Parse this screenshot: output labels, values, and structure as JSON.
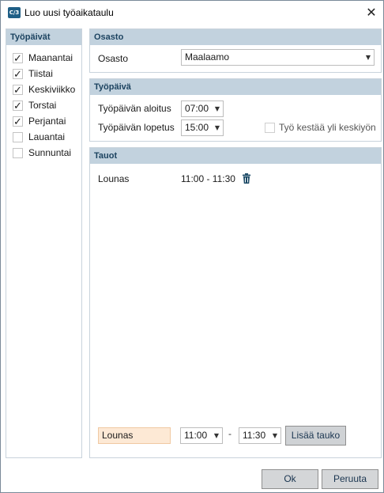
{
  "window": {
    "title": "Luo uusi työaikataulu",
    "icon_text": "C/3",
    "close_glyph": "✕"
  },
  "days_panel": {
    "header": "Työpäivät",
    "days": [
      {
        "label": "Maanantai",
        "checked": true
      },
      {
        "label": "Tiistai",
        "checked": true
      },
      {
        "label": "Keskiviikko",
        "checked": true
      },
      {
        "label": "Torstai",
        "checked": true
      },
      {
        "label": "Perjantai",
        "checked": true
      },
      {
        "label": "Lauantai",
        "checked": false
      },
      {
        "label": "Sunnuntai",
        "checked": false
      }
    ]
  },
  "osasto": {
    "header": "Osasto",
    "label": "Osasto",
    "value": "Maalaamo"
  },
  "tyopaiva": {
    "header": "Työpäivä",
    "start_label": "Työpäivän aloitus",
    "start_value": "07:00",
    "end_label": "Työpäivän lopetus",
    "end_value": "15:00",
    "overnight_label": "Työ kestää yli keskiyön",
    "overnight_checked": false
  },
  "tauot": {
    "header": "Tauot",
    "breaks": [
      {
        "name": "Lounas",
        "time": "11:00 - 11:30"
      }
    ],
    "new_break": {
      "name_value": "Lounas",
      "start_value": "11:00",
      "separator": "-",
      "end_value": "11:30",
      "add_label": "Lisää tauko"
    }
  },
  "footer": {
    "ok_label": "Ok",
    "cancel_label": "Peruuta"
  },
  "colors": {
    "header_bg": "#c2d2de",
    "header_text": "#1c4360",
    "input_highlight": "#fde9d5",
    "button_bg": "#cfd2d5"
  }
}
